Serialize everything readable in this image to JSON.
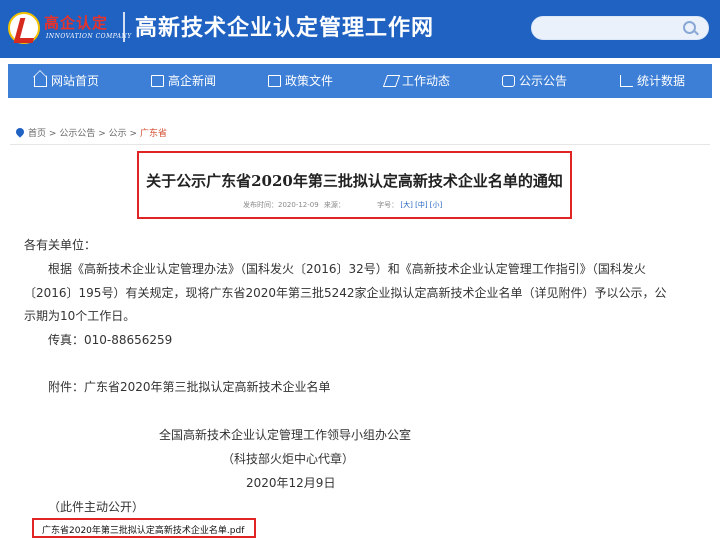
{
  "header": {
    "logo_cn": "高企认定",
    "logo_en": "INNOVATION COMPANY",
    "site_title": "高新技术企业认定管理工作网",
    "search": {
      "placeholder": ""
    }
  },
  "nav": {
    "items": [
      {
        "label": "网站首页",
        "icon": "home-icon"
      },
      {
        "label": "高企新闻",
        "icon": "document-icon"
      },
      {
        "label": "政策文件",
        "icon": "file-icon"
      },
      {
        "label": "工作动态",
        "icon": "send-icon"
      },
      {
        "label": "公示公告",
        "icon": "notice-icon"
      },
      {
        "label": "统计数据",
        "icon": "chart-icon"
      }
    ]
  },
  "breadcrumb": {
    "home": "首页",
    "sep": ">",
    "level1": "公示公告",
    "level2": "公示",
    "current": "广东省"
  },
  "article": {
    "title": "关于公示广东省2020年第三批拟认定高新技术企业名单的通知",
    "publish_label": "发布时间：2020-12-09",
    "source_label": "来源：",
    "font_label": "字号：",
    "font_large": "[大]",
    "font_medium": "[中]",
    "font_small": "[小]"
  },
  "content": {
    "salutation": "各有关单位：",
    "para1_line1": "根据《高新技术企业认定管理办法》（国科发火〔2016〕32号）和《高新技术企业认定管理工作指引》（国科发火",
    "para1_line2": "〔2016〕195号）有关规定，现将广东省2020年第三批5242家企业拟认定高新技术企业名单（详见附件）予以公示，公",
    "para1_line3": "示期为10个工作日。",
    "fax": "传真：010-88656259",
    "attachment_note": "附件：广东省2020年第三批拟认定高新技术企业名单",
    "sign_org": "全国高新技术企业认定管理工作领导小组办公室",
    "sign_sub": "（科技部火炬中心代章）",
    "sign_date": "2020年12月9日",
    "disclosure": "（此件主动公开）",
    "attachment_file": "广东省2020年第三批拟认定高新技术企业名单.pdf"
  },
  "colors": {
    "header_bg": "#1f62c2",
    "nav_bg": "#3d7fd6",
    "highlight_border": "#e02424",
    "breadcrumb_current": "#d34b2c"
  }
}
